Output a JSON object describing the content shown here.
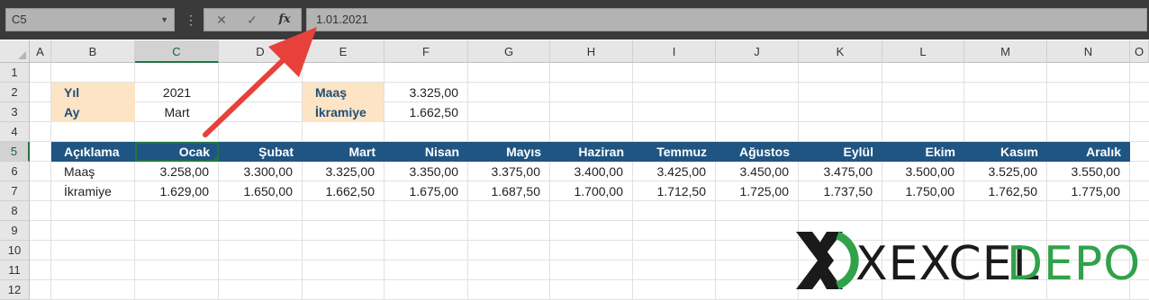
{
  "formula_bar": {
    "name_box": "C5",
    "formula": "1.01.2021",
    "cancel_icon": "✕",
    "enter_icon": "✓",
    "fx_label": "fx",
    "more_icon": "⋮"
  },
  "columns": [
    "A",
    "B",
    "C",
    "D",
    "E",
    "F",
    "G",
    "H",
    "I",
    "J",
    "K",
    "L",
    "M",
    "N",
    "O"
  ],
  "rows": [
    "1",
    "2",
    "3",
    "4",
    "5",
    "6",
    "7",
    "8",
    "9",
    "10",
    "11",
    "12"
  ],
  "params": {
    "yil_label": "Yıl",
    "yil_value": "2021",
    "ay_label": "Ay",
    "ay_value": "Mart",
    "maas_label": "Maaş",
    "maas_value": "3.325,00",
    "ikramiye_label": "İkramiye",
    "ikramiye_value": "1.662,50"
  },
  "table": {
    "headers": [
      "Açıklama",
      "Ocak",
      "Şubat",
      "Mart",
      "Nisan",
      "Mayıs",
      "Haziran",
      "Temmuz",
      "Ağustos",
      "Eylül",
      "Ekim",
      "Kasım",
      "Aralık"
    ],
    "rows": [
      [
        "Maaş",
        "3.258,00",
        "3.300,00",
        "3.325,00",
        "3.350,00",
        "3.375,00",
        "3.400,00",
        "3.425,00",
        "3.450,00",
        "3.475,00",
        "3.500,00",
        "3.525,00",
        "3.550,00"
      ],
      [
        "İkramiye",
        "1.629,00",
        "1.650,00",
        "1.662,50",
        "1.675,00",
        "1.687,50",
        "1.700,00",
        "1.712,50",
        "1.725,00",
        "1.737,50",
        "1.750,00",
        "1.762,50",
        "1.775,00"
      ]
    ]
  },
  "logo": {
    "part1": "XEXCEL",
    "part2": "DEPO",
    "colors": {
      "dark": "#1a1a1a",
      "green": "#2fa24a"
    }
  },
  "colors": {
    "header_fill": "#1f5582",
    "label_fill": "#fce4c4",
    "label_text": "#1f4e79",
    "arrow": "#e8403a",
    "selection": "#217346"
  }
}
